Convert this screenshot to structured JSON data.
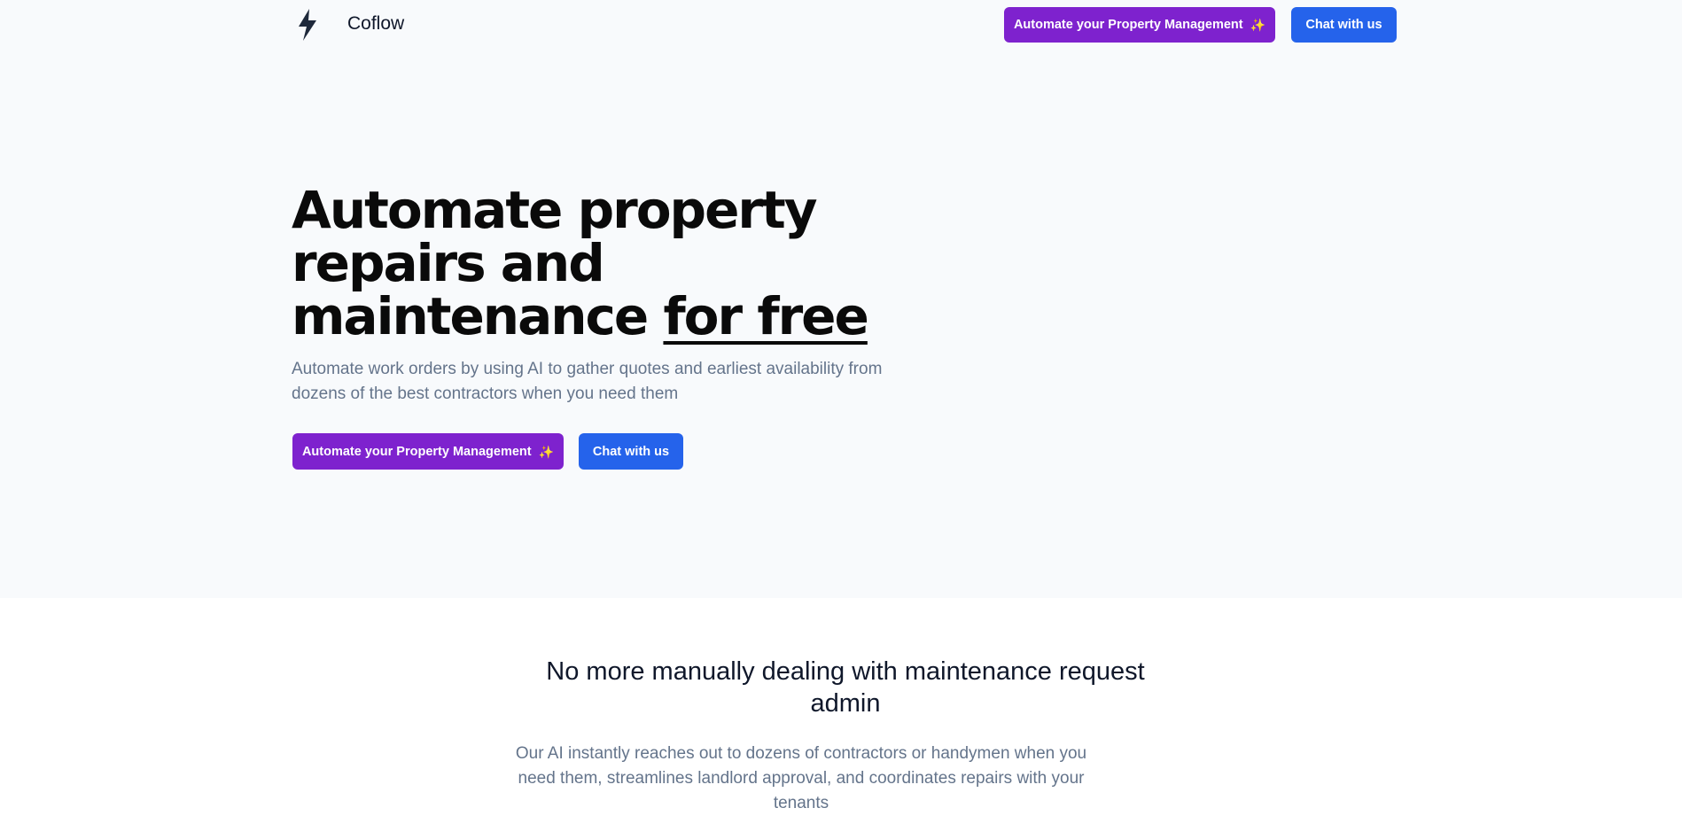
{
  "nav": {
    "brand": "Coflow",
    "cta_primary": "Automate your Property Management",
    "cta_secondary": "Chat with us"
  },
  "hero": {
    "title_main": "Automate property repairs and maintenance ",
    "title_emph": "for free",
    "subtitle": "Automate work orders by using AI to gather quotes and earliest availability from dozens of the best contractors when you need them",
    "cta_primary": "Automate your Property Management",
    "cta_secondary": "Chat with us"
  },
  "section": {
    "title": "No more manually dealing with maintenance request admin",
    "subtitle": "Our AI instantly reaches out to dozens of contractors or handymen when you need them, streamlines landlord approval, and coordinates repairs with your tenants"
  },
  "icons": {
    "logo": "lightning-bolt-icon",
    "sparkle": "sparkle-icon"
  },
  "colors": {
    "primary_button": "#7e22ce",
    "secondary_button": "#2563eb",
    "hero_background": "#f8fafc",
    "heading": "#0a0a0a",
    "muted_text": "#64748b"
  }
}
